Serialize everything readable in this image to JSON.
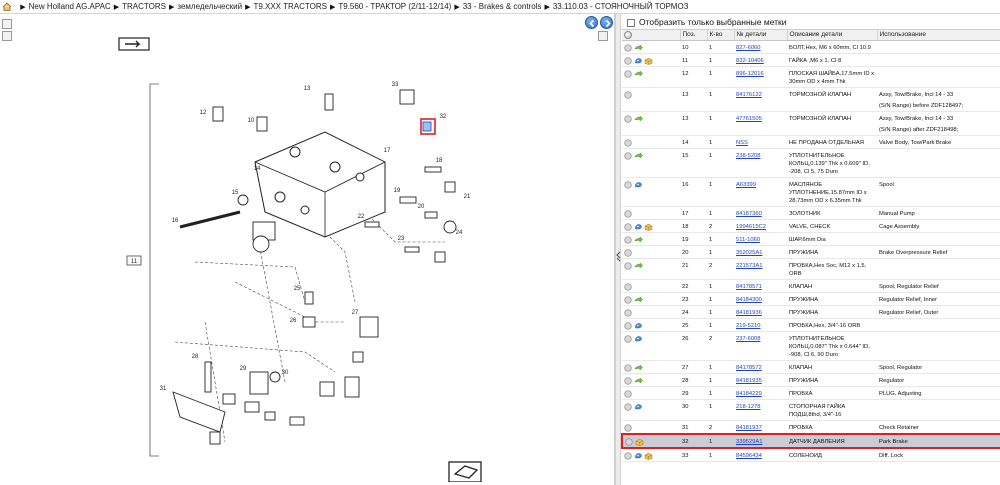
{
  "breadcrumb": [
    "New Holland AG.APAC",
    "TRACTORS",
    "земледельческий",
    "T9.XXX TRACTORS",
    "T9.560 - ТРАКТОР (2/11-12/14)",
    "33 - Brakes & controls",
    "33.110.03 - СТОЯНОЧНЫЙ ТОРМОЗ"
  ],
  "filter_label": "Отобразить только выбранные метки",
  "columns": [
    "",
    "Поз.",
    "К-во",
    "№ детали",
    "Описание детали",
    "Использование"
  ],
  "rows": [
    {
      "icons": [
        "grey",
        "arrow"
      ],
      "pos": "10",
      "qty": "1",
      "part": "827-6060",
      "desc": "БОЛТ,Hex, M6 x 60mm, Cl 10.9",
      "usage": ""
    },
    {
      "icons": [
        "grey",
        "info",
        "package"
      ],
      "pos": "11",
      "qty": "1",
      "part": "832-10406",
      "desc": "ГАЙКА ,M6 x 1, Cl 8",
      "usage": ""
    },
    {
      "icons": [
        "grey",
        "arrow"
      ],
      "pos": "12",
      "qty": "1",
      "part": "896-12016",
      "desc": "ПЛОСКАЯ ШАЙБА,17.5mm ID x 30mm OD x 4mm Thk",
      "usage": ""
    },
    {
      "icons": [
        "grey"
      ],
      "pos": "13",
      "qty": "1",
      "part": "84176122",
      "desc": "ТОРМОЗНОЙ КЛАПАН",
      "usage": "Assy, Tow/Brake, Incl 14 - 33",
      "usage2": "(S/N Range) before ZDF128497;"
    },
    {
      "icons": [
        "grey",
        "arrow"
      ],
      "pos": "13",
      "qty": "1",
      "part": "47761505",
      "desc": "ТОРМОЗНОЙ КЛАПАН",
      "usage": "Assy, Tow/Brake, Incl 14 - 33",
      "usage2": "(S/N Range) after ZDF218498;"
    },
    {
      "icons": [
        "grey"
      ],
      "pos": "14",
      "qty": "1",
      "part": "NSS",
      "desc": "НЕ ПРОДАНА ОТДЕЛЬНАЯ",
      "usage": "Valve Body, Tow/Park Brake"
    },
    {
      "icons": [
        "grey",
        "arrow"
      ],
      "pos": "15",
      "qty": "1",
      "part": "238-5208",
      "desc": "УПЛОТНИТЕЛЬНОЕ КОЛЬЦ,0.139\" Thk x 0.609\" ID, -208, Cl 5, 75 Duro",
      "usage": ""
    },
    {
      "icons": [
        "grey",
        "info"
      ],
      "pos": "16",
      "qty": "1",
      "part": "A63399",
      "desc": "МАСЛЯНОЕ УПЛОТНЕНИЕ,15.87mm ID x 28.73mm OD x 6.35mm Thk",
      "usage": "Spool"
    },
    {
      "icons": [
        "grey"
      ],
      "pos": "17",
      "qty": "1",
      "part": "84187360",
      "desc": "ЗОЛОТНИК",
      "usage": "Manual Pump"
    },
    {
      "icons": [
        "grey",
        "info",
        "package"
      ],
      "pos": "18",
      "qty": "2",
      "part": "1994615C2",
      "desc": "VALVE, CHECK",
      "usage": "Cage Assembly"
    },
    {
      "icons": [
        "grey",
        "arrow"
      ],
      "pos": "19",
      "qty": "1",
      "part": "511-1060",
      "desc": "ШАР,6mm Dia",
      "usage": ""
    },
    {
      "icons": [
        "grey"
      ],
      "pos": "20",
      "qty": "1",
      "part": "352025A1",
      "desc": "ПРУЖИНА",
      "usage": "Brake Overpressure Relief"
    },
    {
      "icons": [
        "grey",
        "arrow"
      ],
      "pos": "21",
      "qty": "2",
      "part": "221573A1",
      "desc": "ПРОБКА,Hex Soc, M12 x 1.5, ORB",
      "usage": ""
    },
    {
      "icons": [
        "grey"
      ],
      "pos": "22",
      "qty": "1",
      "part": "84178571",
      "desc": "КЛАПАН",
      "usage": "Spool, Regulator Relief"
    },
    {
      "icons": [
        "grey",
        "arrow"
      ],
      "pos": "23",
      "qty": "1",
      "part": "84184300",
      "desc": "ПРУЖИНА",
      "usage": "Regulator Relief, Inner"
    },
    {
      "icons": [
        "grey"
      ],
      "pos": "24",
      "qty": "1",
      "part": "84181936",
      "desc": "ПРУЖИНА",
      "usage": "Regulator Relief, Outer"
    },
    {
      "icons": [
        "grey",
        "info"
      ],
      "pos": "25",
      "qty": "1",
      "part": "219-5210",
      "desc": "ПРОБКА,Hex, 3/4\"-16 ORB",
      "usage": ""
    },
    {
      "icons": [
        "grey",
        "info"
      ],
      "pos": "26",
      "qty": "2",
      "part": "237-6008",
      "desc": "УПЛОТНИТЕЛЬНОЕ КОЛЬЦ,0.087\" Thk x 0.644\" ID, -908, Cl 6, 90 Duro",
      "usage": ""
    },
    {
      "icons": [
        "grey",
        "arrow"
      ],
      "pos": "27",
      "qty": "1",
      "part": "84178572",
      "desc": "КЛАПАН",
      "usage": "Spool, Regulator"
    },
    {
      "icons": [
        "grey",
        "arrow"
      ],
      "pos": "28",
      "qty": "1",
      "part": "84181935",
      "desc": "ПРУЖИНА",
      "usage": "Regulator"
    },
    {
      "icons": [
        "grey"
      ],
      "pos": "29",
      "qty": "1",
      "part": "84184229",
      "desc": "ПРОБКА",
      "usage": "PLUG, Adjusting"
    },
    {
      "icons": [
        "grey",
        "info"
      ],
      "pos": "30",
      "qty": "1",
      "part": "218-1278",
      "desc": "СТОПОРНАЯ ГАЙКА ПОДШ,8thd, 3/4\"-16",
      "usage": ""
    },
    {
      "icons": [
        "grey"
      ],
      "pos": "31",
      "qty": "2",
      "part": "84181937",
      "desc": "ПРОБКА",
      "usage": "Check Retainer"
    },
    {
      "icons": [
        "grey",
        "package"
      ],
      "pos": "32",
      "qty": "1",
      "part": "339529A1",
      "desc": "ДАТЧИК ДАВЛЕНИЯ",
      "usage": "Park Brake",
      "highlight": true
    },
    {
      "icons": [
        "grey",
        "info",
        "package"
      ],
      "pos": "33",
      "qty": "1",
      "part": "84596434",
      "desc": "СОЛЕНОИД",
      "usage": "Diff. Lock"
    }
  ],
  "diagram": {
    "callouts": [
      "11",
      "12",
      "10",
      "13",
      "14",
      "15",
      "16",
      "17",
      "18",
      "19",
      "20",
      "21",
      "22",
      "23",
      "24",
      "25",
      "26",
      "27",
      "28",
      "29",
      "30",
      "31",
      "32",
      "33"
    ]
  }
}
